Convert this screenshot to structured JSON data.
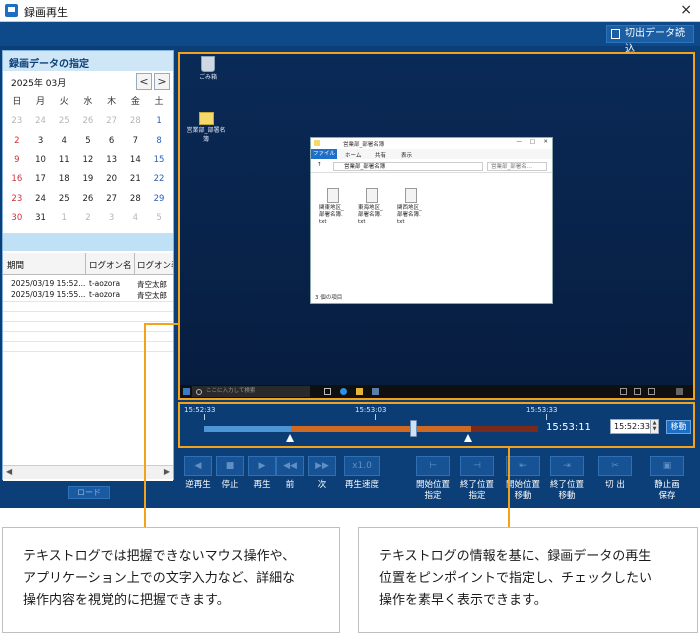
{
  "window": {
    "title": "録画再生",
    "close_glyph": "×"
  },
  "toolbar": {
    "load_cut_label": "切出データ読込"
  },
  "calendar": {
    "header": "録画データの指定",
    "month_label": "2025年 03月",
    "prev_glyph": "<",
    "next_glyph": ">",
    "weekdays": [
      "日",
      "月",
      "火",
      "水",
      "木",
      "金",
      "土"
    ],
    "weeks": [
      [
        "23",
        "24",
        "25",
        "26",
        "27",
        "28",
        "1"
      ],
      [
        "2",
        "3",
        "4",
        "5",
        "6",
        "7",
        "8"
      ],
      [
        "9",
        "10",
        "11",
        "12",
        "13",
        "14",
        "15"
      ],
      [
        "16",
        "17",
        "18",
        "19",
        "20",
        "21",
        "22"
      ],
      [
        "23",
        "24",
        "25",
        "26",
        "27",
        "28",
        "29"
      ],
      [
        "30",
        "31",
        "1",
        "2",
        "3",
        "4",
        "5"
      ]
    ]
  },
  "log_table": {
    "headers": [
      "期間",
      "ログオン名",
      "ログオン表"
    ],
    "rows": [
      [
        "2025/03/19 15:52...",
        "t-aozora",
        "青空太郎"
      ],
      [
        "2025/03/19 15:55...",
        "t-aozora",
        "青空太郎"
      ]
    ],
    "load_label": "ロード"
  },
  "desktop": {
    "trash_label": "ごみ箱",
    "folder_label": "営業部_部署名簿",
    "explorer": {
      "title": "営業部_部署名簿",
      "tabs": [
        "ファイル",
        "ホーム",
        "共有",
        "表示"
      ],
      "address": "営業部_部署名簿",
      "search_placeholder": "営業部_部署名...",
      "files": [
        {
          "l1": "関東地区_",
          "l2": "部署名簿.",
          "l3": "txt"
        },
        {
          "l1": "東海地区_",
          "l2": "部署名簿.",
          "l3": "txt"
        },
        {
          "l1": "関西地区_",
          "l2": "部署名簿.",
          "l3": "txt"
        }
      ],
      "status": "3 個の項目"
    },
    "taskbar_search": "ここに入力して検索"
  },
  "timeline": {
    "labels": [
      "15:52:33",
      "15:53:03",
      "15:53:33"
    ],
    "current_time": "15:53:11",
    "input_value": "15:52:33",
    "move_label": "移動",
    "played_fraction": 0.26,
    "range_start_fraction": 0.26,
    "range_end_fraction": 0.8
  },
  "controls": {
    "reverse": "逆再生",
    "stop": "停止",
    "play": "再生",
    "prev": "前",
    "next": "次",
    "speed": "再生速度",
    "speed_value": "x1.0",
    "start_pos_1": "開始位置",
    "start_pos_2": "指定",
    "end_pos_1": "終了位置",
    "end_pos_2": "指定",
    "start_move_1": "開始位置",
    "start_move_2": "移動",
    "end_move_1": "終了位置",
    "end_move_2": "移動",
    "cut": "切 出",
    "still_1": "静止画",
    "still_2": "保存"
  },
  "callouts": {
    "left": [
      "テキストログでは把握できないマウス操作や、",
      "アプリケーション上での文字入力など、詳細な",
      "操作内容を視覚的に把握できます。"
    ],
    "right": [
      "テキストログの情報を基に、録画データの再生",
      "位置をピンポイントで指定し、チェックしたい",
      "操作を素早く表示できます。"
    ]
  },
  "colors": {
    "accent": "#f3a31b",
    "app_bg": "#0c3f78",
    "sunday": "#d0303a",
    "saturday": "#2a5fb8"
  }
}
